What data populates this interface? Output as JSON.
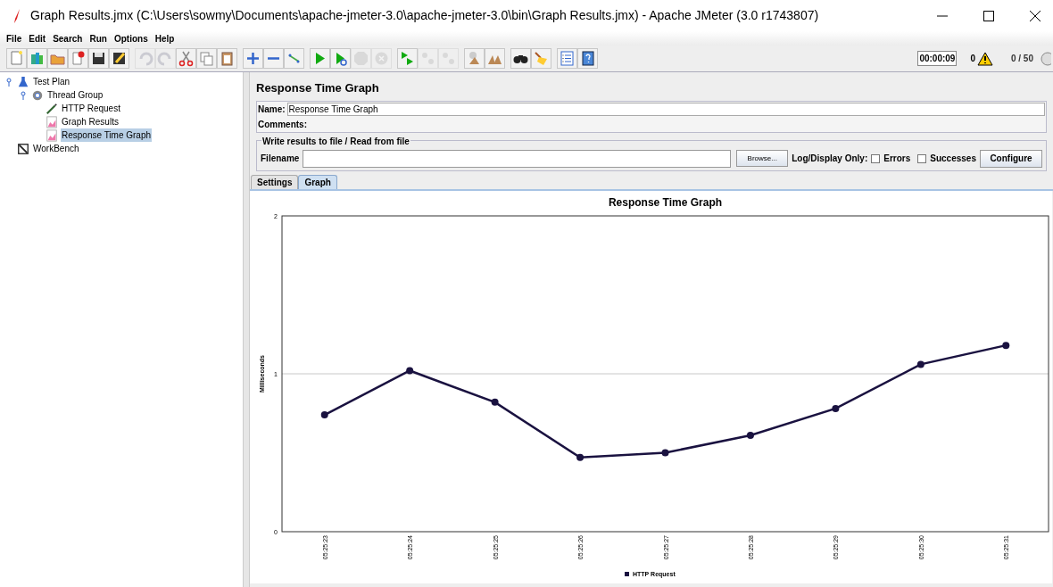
{
  "window": {
    "title": "Graph Results.jmx (C:\\Users\\sowmy\\Documents\\apache-jmeter-3.0\\apache-jmeter-3.0\\bin\\Graph Results.jmx) - Apache JMeter (3.0 r1743807)"
  },
  "menu": [
    "File",
    "Edit",
    "Search",
    "Run",
    "Options",
    "Help"
  ],
  "toolbar": [
    [
      {
        "kind": "new",
        "disabled": false
      },
      {
        "kind": "templates",
        "disabled": false
      },
      {
        "kind": "open",
        "disabled": false
      },
      {
        "kind": "close",
        "disabled": false
      },
      {
        "kind": "save",
        "disabled": false
      },
      {
        "kind": "saveas",
        "disabled": false
      }
    ],
    [
      {
        "kind": "undo",
        "disabled": true
      },
      {
        "kind": "redo",
        "disabled": true
      },
      {
        "kind": "cut",
        "disabled": false
      },
      {
        "kind": "copy",
        "disabled": false
      },
      {
        "kind": "paste",
        "disabled": false
      }
    ],
    [
      {
        "kind": "expand",
        "disabled": false
      },
      {
        "kind": "collapse",
        "disabled": false
      },
      {
        "kind": "toggle",
        "disabled": false
      }
    ],
    [
      {
        "kind": "start",
        "disabled": false
      },
      {
        "kind": "startnp",
        "disabled": false
      },
      {
        "kind": "stop",
        "disabled": true
      },
      {
        "kind": "shutdown",
        "disabled": true
      }
    ],
    [
      {
        "kind": "remotestart",
        "disabled": false
      },
      {
        "kind": "remotestop",
        "disabled": true
      },
      {
        "kind": "remoteexit",
        "disabled": true
      }
    ],
    [
      {
        "kind": "clear",
        "disabled": false
      },
      {
        "kind": "clearall",
        "disabled": false
      }
    ],
    [
      {
        "kind": "search",
        "disabled": false
      },
      {
        "kind": "reset",
        "disabled": false
      }
    ],
    [
      {
        "kind": "functions",
        "disabled": false
      },
      {
        "kind": "help",
        "disabled": false
      }
    ]
  ],
  "status": {
    "elapsed": "00:00:09",
    "errors": "0",
    "threads": "0 / 50"
  },
  "tree": [
    {
      "label": "Test Plan",
      "kind": "plan",
      "selected": false,
      "children": [
        {
          "label": "Thread Group",
          "kind": "threads",
          "selected": false,
          "children": [
            {
              "label": "HTTP Request",
              "kind": "sampler",
              "selected": false
            },
            {
              "label": "Graph Results",
              "kind": "listener",
              "selected": false
            },
            {
              "label": "Response Time Graph",
              "kind": "listener",
              "selected": true
            }
          ]
        }
      ]
    },
    {
      "label": "WorkBench",
      "kind": "workbench",
      "selected": false
    }
  ],
  "panel": {
    "title": "Response Time Graph",
    "name_label": "Name:",
    "name_value": "Response Time Graph",
    "comments_label": "Comments:",
    "file_group": {
      "legend": "Write results to file / Read from file",
      "filename_label": "Filename",
      "browse": "Browse...",
      "log_label": "Log/Display Only:",
      "options": [
        {
          "label": "Errors",
          "checked": false
        },
        {
          "label": "Successes",
          "checked": false
        }
      ],
      "configure": "Configure"
    },
    "tabs": [
      {
        "label": "Settings",
        "selected": false
      },
      {
        "label": "Graph",
        "selected": true
      }
    ]
  },
  "chart_data": {
    "type": "line",
    "title": "Response Time Graph",
    "ylabel": "Milliseconds",
    "categories": [
      "05:25:23",
      "05:25:24",
      "05:25:25",
      "05:25:26",
      "05:25:27",
      "05:25:28",
      "05:25:29",
      "05:25:30",
      "05:25:31"
    ],
    "series": [
      {
        "name": "HTTP Request",
        "color": "#1a1240",
        "marker": "circle",
        "values": [
          0.74,
          1.02,
          0.82,
          0.47,
          0.5,
          0.61,
          0.78,
          1.06,
          1.18
        ]
      }
    ],
    "ylim": [
      0,
      2
    ],
    "yticks": [
      0,
      1,
      2
    ]
  }
}
